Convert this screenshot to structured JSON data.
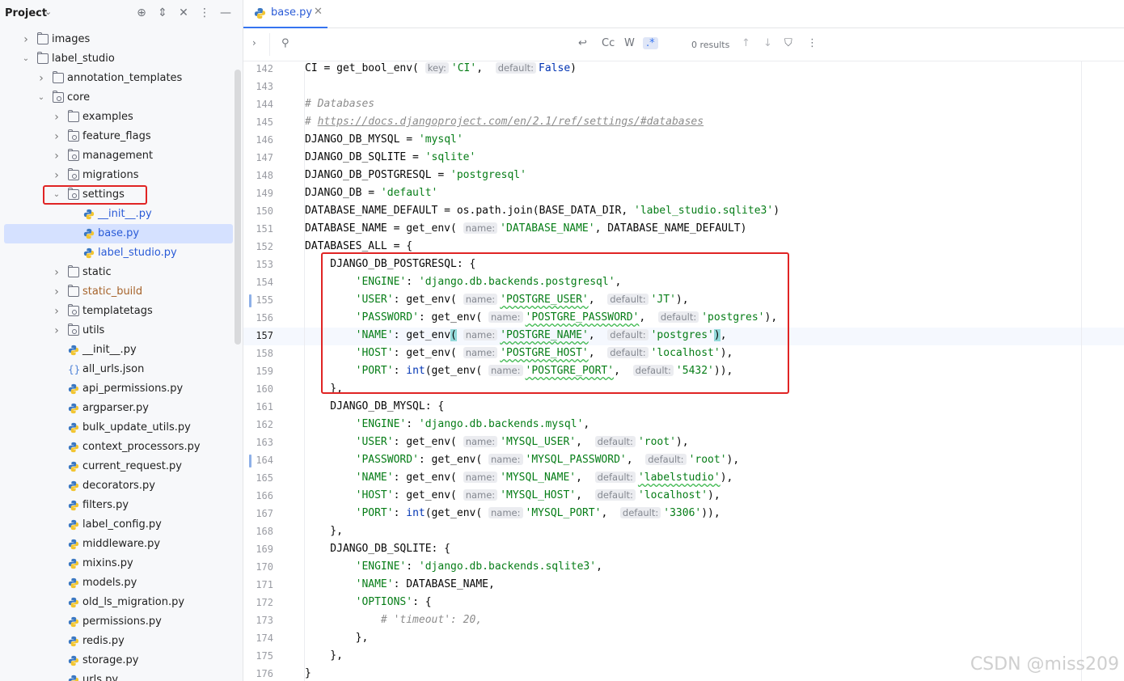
{
  "sidebar": {
    "title": "Project",
    "tree": [
      {
        "label": "images",
        "kind": "folder",
        "arrow": "right",
        "depth": 1
      },
      {
        "label": "label_studio",
        "kind": "folder",
        "arrow": "down",
        "depth": 1
      },
      {
        "label": "annotation_templates",
        "kind": "folder",
        "arrow": "right",
        "depth": 2
      },
      {
        "label": "core",
        "kind": "package",
        "arrow": "down",
        "depth": 2
      },
      {
        "label": "examples",
        "kind": "folder",
        "arrow": "right",
        "depth": 3
      },
      {
        "label": "feature_flags",
        "kind": "package",
        "arrow": "right",
        "depth": 3
      },
      {
        "label": "management",
        "kind": "package",
        "arrow": "right",
        "depth": 3
      },
      {
        "label": "migrations",
        "kind": "package",
        "arrow": "right",
        "depth": 3
      },
      {
        "label": "settings",
        "kind": "package",
        "arrow": "down",
        "depth": 3
      },
      {
        "label": "__init__.py",
        "kind": "python",
        "arrow": "",
        "depth": 4
      },
      {
        "label": "base.py",
        "kind": "python",
        "arrow": "",
        "depth": 4,
        "selected": true
      },
      {
        "label": "label_studio.py",
        "kind": "python",
        "arrow": "",
        "depth": 4
      },
      {
        "label": "static",
        "kind": "folder",
        "arrow": "right",
        "depth": 3
      },
      {
        "label": "static_build",
        "kind": "folder",
        "arrow": "right",
        "depth": 3,
        "color": "#a6632b"
      },
      {
        "label": "templatetags",
        "kind": "package",
        "arrow": "right",
        "depth": 3
      },
      {
        "label": "utils",
        "kind": "package",
        "arrow": "right",
        "depth": 3
      },
      {
        "label": "__init__.py",
        "kind": "python",
        "arrow": "",
        "depth": 3
      },
      {
        "label": "all_urls.json",
        "kind": "json",
        "arrow": "",
        "depth": 3
      },
      {
        "label": "api_permissions.py",
        "kind": "python",
        "arrow": "",
        "depth": 3
      },
      {
        "label": "argparser.py",
        "kind": "python",
        "arrow": "",
        "depth": 3
      },
      {
        "label": "bulk_update_utils.py",
        "kind": "python",
        "arrow": "",
        "depth": 3
      },
      {
        "label": "context_processors.py",
        "kind": "python",
        "arrow": "",
        "depth": 3
      },
      {
        "label": "current_request.py",
        "kind": "python",
        "arrow": "",
        "depth": 3
      },
      {
        "label": "decorators.py",
        "kind": "python",
        "arrow": "",
        "depth": 3
      },
      {
        "label": "filters.py",
        "kind": "python",
        "arrow": "",
        "depth": 3
      },
      {
        "label": "label_config.py",
        "kind": "python",
        "arrow": "",
        "depth": 3
      },
      {
        "label": "middleware.py",
        "kind": "python",
        "arrow": "",
        "depth": 3
      },
      {
        "label": "mixins.py",
        "kind": "python",
        "arrow": "",
        "depth": 3
      },
      {
        "label": "models.py",
        "kind": "python",
        "arrow": "",
        "depth": 3
      },
      {
        "label": "old_ls_migration.py",
        "kind": "python",
        "arrow": "",
        "depth": 3
      },
      {
        "label": "permissions.py",
        "kind": "python",
        "arrow": "",
        "depth": 3
      },
      {
        "label": "redis.py",
        "kind": "python",
        "arrow": "",
        "depth": 3
      },
      {
        "label": "storage.py",
        "kind": "python",
        "arrow": "",
        "depth": 3
      },
      {
        "label": "urls.py",
        "kind": "python",
        "arrow": "",
        "depth": 3
      }
    ]
  },
  "editor": {
    "tab_name": "base.py",
    "find": {
      "case_label": "Cc",
      "word_label": "W",
      "regex_label": ".*",
      "results": "0 results"
    },
    "lines": [
      {
        "n": "142",
        "parts": [
          [
            "t",
            "CI = get_bool_env( "
          ],
          [
            "h",
            "key:"
          ],
          [
            "s",
            "'CI'"
          ],
          [
            "t",
            ",  "
          ],
          [
            "h",
            "default:"
          ],
          [
            "k",
            "False"
          ],
          [
            "t",
            ")"
          ]
        ]
      },
      {
        "n": "143",
        "parts": []
      },
      {
        "n": "144",
        "parts": [
          [
            "c",
            "# Databases"
          ]
        ]
      },
      {
        "n": "145",
        "parts": [
          [
            "c",
            "# "
          ],
          [
            "u",
            "https://docs.djangoproject.com/en/2.1/ref/settings/#databases"
          ]
        ]
      },
      {
        "n": "146",
        "parts": [
          [
            "t",
            "DJANGO_DB_MYSQL = "
          ],
          [
            "s",
            "'mysql'"
          ]
        ]
      },
      {
        "n": "147",
        "parts": [
          [
            "t",
            "DJANGO_DB_SQLITE = "
          ],
          [
            "s",
            "'sqlite'"
          ]
        ]
      },
      {
        "n": "148",
        "parts": [
          [
            "t",
            "DJANGO_DB_POSTGRESQL = "
          ],
          [
            "s",
            "'postgresql'"
          ]
        ]
      },
      {
        "n": "149",
        "parts": [
          [
            "t",
            "DJANGO_DB = "
          ],
          [
            "s",
            "'default'"
          ]
        ]
      },
      {
        "n": "150",
        "parts": [
          [
            "t",
            "DATABASE_NAME_DEFAULT = os.path.join(BASE_DATA_DIR, "
          ],
          [
            "s",
            "'label_studio.sqlite3'"
          ],
          [
            "t",
            ")"
          ]
        ]
      },
      {
        "n": "151",
        "parts": [
          [
            "t",
            "DATABASE_NAME = get_env( "
          ],
          [
            "h",
            "name:"
          ],
          [
            "s",
            "'DATABASE_NAME'"
          ],
          [
            "t",
            ", DATABASE_NAME_DEFAULT)"
          ]
        ]
      },
      {
        "n": "152",
        "parts": [
          [
            "t",
            "DATABASES_ALL = {"
          ]
        ]
      },
      {
        "n": "153",
        "parts": [
          [
            "t",
            "    DJANGO_DB_POSTGRESQL: {"
          ]
        ]
      },
      {
        "n": "154",
        "parts": [
          [
            "t",
            "        "
          ],
          [
            "s",
            "'ENGINE'"
          ],
          [
            "t",
            ": "
          ],
          [
            "s",
            "'django.db.backends.postgresql'"
          ],
          [
            "t",
            ","
          ]
        ]
      },
      {
        "n": "155",
        "mark": true,
        "parts": [
          [
            "t",
            "        "
          ],
          [
            "s",
            "'USER'"
          ],
          [
            "t",
            ": get_env( "
          ],
          [
            "h",
            "name:"
          ],
          [
            "sw",
            "'POSTGRE_USER'"
          ],
          [
            "t",
            ",  "
          ],
          [
            "h",
            "default:"
          ],
          [
            "s",
            "'JT'"
          ],
          [
            "t",
            "),"
          ]
        ]
      },
      {
        "n": "156",
        "parts": [
          [
            "t",
            "        "
          ],
          [
            "s",
            "'PASSWORD'"
          ],
          [
            "t",
            ": get_env( "
          ],
          [
            "h",
            "name:"
          ],
          [
            "sw",
            "'POSTGRE_PASSWORD'"
          ],
          [
            "t",
            ",  "
          ],
          [
            "h",
            "default:"
          ],
          [
            "s",
            "'postgres'"
          ],
          [
            "t",
            "),"
          ]
        ]
      },
      {
        "n": "157",
        "cur": true,
        "parts": [
          [
            "t",
            "        "
          ],
          [
            "s",
            "'NAME'"
          ],
          [
            "t",
            ": get_env"
          ],
          [
            "b",
            "("
          ],
          [
            "t",
            " "
          ],
          [
            "h",
            "name:"
          ],
          [
            "sw",
            "'POSTGRE_NAME'"
          ],
          [
            "t",
            ",  "
          ],
          [
            "h",
            "default:"
          ],
          [
            "s",
            "'postgres'"
          ],
          [
            "b",
            ")"
          ],
          [
            "t",
            ","
          ]
        ]
      },
      {
        "n": "158",
        "parts": [
          [
            "t",
            "        "
          ],
          [
            "s",
            "'HOST'"
          ],
          [
            "t",
            ": get_env( "
          ],
          [
            "h",
            "name:"
          ],
          [
            "sw",
            "'POSTGRE_HOST'"
          ],
          [
            "t",
            ",  "
          ],
          [
            "h",
            "default:"
          ],
          [
            "s",
            "'localhost'"
          ],
          [
            "t",
            "),"
          ]
        ]
      },
      {
        "n": "159",
        "parts": [
          [
            "t",
            "        "
          ],
          [
            "s",
            "'PORT'"
          ],
          [
            "t",
            ": "
          ],
          [
            "k",
            "int"
          ],
          [
            "t",
            "(get_env( "
          ],
          [
            "h",
            "name:"
          ],
          [
            "sw",
            "'POSTGRE_PORT'"
          ],
          [
            "t",
            ",  "
          ],
          [
            "h",
            "default:"
          ],
          [
            "s",
            "'5432'"
          ],
          [
            "t",
            ")),"
          ]
        ]
      },
      {
        "n": "160",
        "parts": [
          [
            "t",
            "    },"
          ]
        ]
      },
      {
        "n": "161",
        "parts": [
          [
            "t",
            "    DJANGO_DB_MYSQL: {"
          ]
        ]
      },
      {
        "n": "162",
        "parts": [
          [
            "t",
            "        "
          ],
          [
            "s",
            "'ENGINE'"
          ],
          [
            "t",
            ": "
          ],
          [
            "s",
            "'django.db.backends.mysql'"
          ],
          [
            "t",
            ","
          ]
        ]
      },
      {
        "n": "163",
        "parts": [
          [
            "t",
            "        "
          ],
          [
            "s",
            "'USER'"
          ],
          [
            "t",
            ": get_env( "
          ],
          [
            "h",
            "name:"
          ],
          [
            "s",
            "'MYSQL_USER'"
          ],
          [
            "t",
            ",  "
          ],
          [
            "h",
            "default:"
          ],
          [
            "s",
            "'root'"
          ],
          [
            "t",
            "),"
          ]
        ]
      },
      {
        "n": "164",
        "mark": true,
        "parts": [
          [
            "t",
            "        "
          ],
          [
            "s",
            "'PASSWORD'"
          ],
          [
            "t",
            ": get_env( "
          ],
          [
            "h",
            "name:"
          ],
          [
            "s",
            "'MYSQL_PASSWORD'"
          ],
          [
            "t",
            ",  "
          ],
          [
            "h",
            "default:"
          ],
          [
            "s",
            "'root'"
          ],
          [
            "t",
            "),"
          ]
        ]
      },
      {
        "n": "165",
        "parts": [
          [
            "t",
            "        "
          ],
          [
            "s",
            "'NAME'"
          ],
          [
            "t",
            ": get_env( "
          ],
          [
            "h",
            "name:"
          ],
          [
            "s",
            "'MYSQL_NAME'"
          ],
          [
            "t",
            ",  "
          ],
          [
            "h",
            "default:"
          ],
          [
            "sw",
            "'labelstudio'"
          ],
          [
            "t",
            "),"
          ]
        ]
      },
      {
        "n": "166",
        "parts": [
          [
            "t",
            "        "
          ],
          [
            "s",
            "'HOST'"
          ],
          [
            "t",
            ": get_env( "
          ],
          [
            "h",
            "name:"
          ],
          [
            "s",
            "'MYSQL_HOST'"
          ],
          [
            "t",
            ",  "
          ],
          [
            "h",
            "default:"
          ],
          [
            "s",
            "'localhost'"
          ],
          [
            "t",
            "),"
          ]
        ]
      },
      {
        "n": "167",
        "parts": [
          [
            "t",
            "        "
          ],
          [
            "s",
            "'PORT'"
          ],
          [
            "t",
            ": "
          ],
          [
            "k",
            "int"
          ],
          [
            "t",
            "(get_env( "
          ],
          [
            "h",
            "name:"
          ],
          [
            "s",
            "'MYSQL_PORT'"
          ],
          [
            "t",
            ",  "
          ],
          [
            "h",
            "default:"
          ],
          [
            "s",
            "'3306'"
          ],
          [
            "t",
            ")),"
          ]
        ]
      },
      {
        "n": "168",
        "parts": [
          [
            "t",
            "    },"
          ]
        ]
      },
      {
        "n": "169",
        "parts": [
          [
            "t",
            "    DJANGO_DB_SQLITE: {"
          ]
        ]
      },
      {
        "n": "170",
        "parts": [
          [
            "t",
            "        "
          ],
          [
            "s",
            "'ENGINE'"
          ],
          [
            "t",
            ": "
          ],
          [
            "s",
            "'django.db.backends.sqlite3'"
          ],
          [
            "t",
            ","
          ]
        ]
      },
      {
        "n": "171",
        "parts": [
          [
            "t",
            "        "
          ],
          [
            "s",
            "'NAME'"
          ],
          [
            "t",
            ": DATABASE_NAME,"
          ]
        ]
      },
      {
        "n": "172",
        "parts": [
          [
            "t",
            "        "
          ],
          [
            "s",
            "'OPTIONS'"
          ],
          [
            "t",
            ": {"
          ]
        ]
      },
      {
        "n": "173",
        "parts": [
          [
            "t",
            "            "
          ],
          [
            "c",
            "# 'timeout': 20,"
          ]
        ]
      },
      {
        "n": "174",
        "parts": [
          [
            "t",
            "        },"
          ]
        ]
      },
      {
        "n": "175",
        "parts": [
          [
            "t",
            "    },"
          ]
        ]
      },
      {
        "n": "176",
        "parts": [
          [
            "t",
            "}"
          ]
        ]
      }
    ]
  },
  "watermark": "CSDN @miss209",
  "colors": {
    "string": "#067d17",
    "keyword": "#0033b3",
    "comment": "#8c8c8c",
    "highlight_box": "#e02424",
    "tab_accent": "#3574f0"
  }
}
